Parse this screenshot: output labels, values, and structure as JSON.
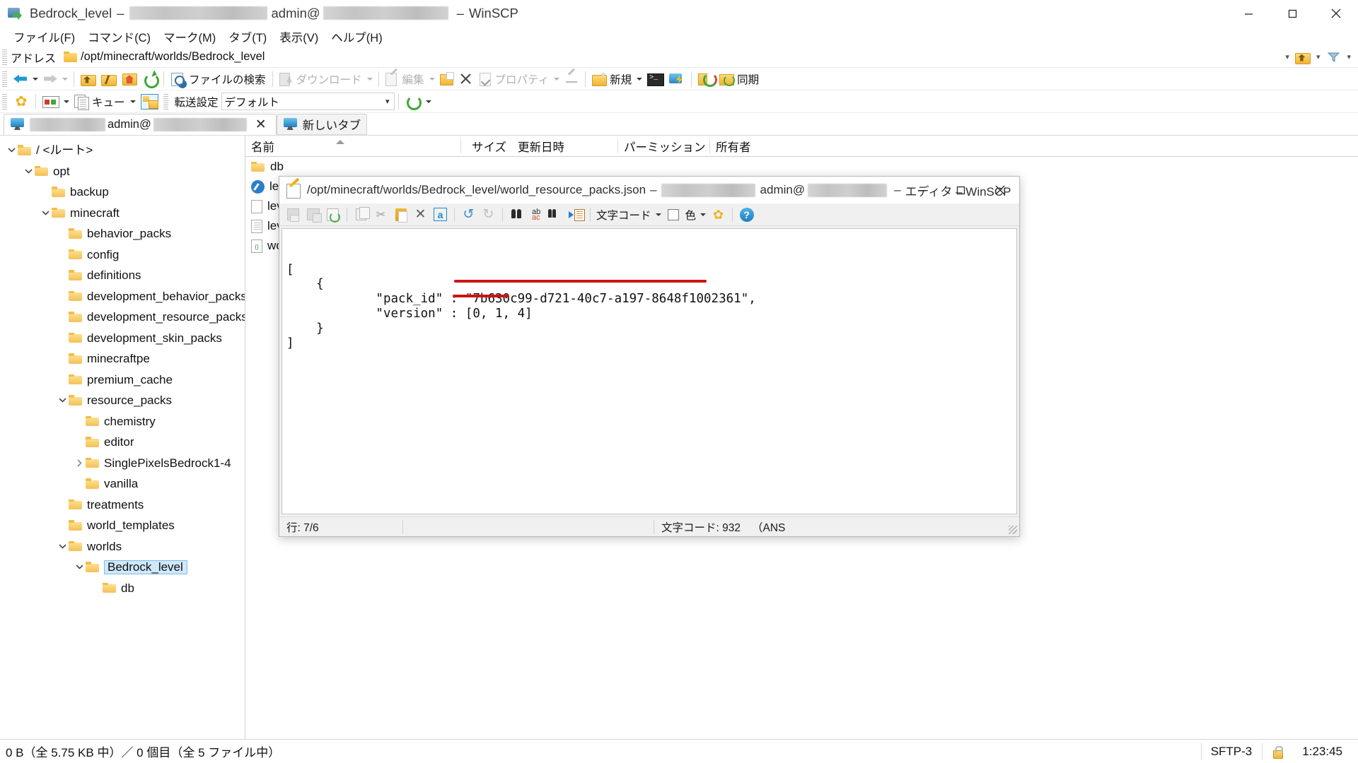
{
  "window": {
    "title_prefix": "Bedrock_level",
    "title_dash1": "–",
    "title_user": "admin@",
    "title_dash2": "–",
    "title_app": "WinSCP",
    "icon": "winscp-folder-arrow-icon"
  },
  "menu": {
    "items": [
      {
        "label": "ファイル(F)",
        "name": "menu-file"
      },
      {
        "label": "コマンド(C)",
        "name": "menu-command"
      },
      {
        "label": "マーク(M)",
        "name": "menu-mark"
      },
      {
        "label": "タブ(T)",
        "name": "menu-tab"
      },
      {
        "label": "表示(V)",
        "name": "menu-view"
      },
      {
        "label": "ヘルプ(H)",
        "name": "menu-help"
      }
    ]
  },
  "address": {
    "label": "アドレス",
    "path": "/opt/minecraft/worlds/Bedrock_level"
  },
  "toolbar": {
    "back": "",
    "forward": "",
    "search_label": "ファイルの検索",
    "download_label": "ダウンロード",
    "edit_label": "編集",
    "properties_label": "プロパティ",
    "new_label": "新規",
    "sync_label": "同期"
  },
  "toolbar2": {
    "queue_label": "キュー",
    "transfer_settings_label": "転送設定",
    "transfer_settings_value": "デフォルト"
  },
  "tabs": {
    "session_user": "admin@",
    "new_tab_label": "新しいタブ",
    "close_glyph": "✕"
  },
  "tree": [
    {
      "label": "/ <ルート>",
      "depth": 0,
      "state": "expanded",
      "selected": false
    },
    {
      "label": "opt",
      "depth": 1,
      "state": "expanded",
      "selected": false
    },
    {
      "label": "backup",
      "depth": 2,
      "state": "leaf",
      "selected": false
    },
    {
      "label": "minecraft",
      "depth": 2,
      "state": "expanded",
      "selected": false
    },
    {
      "label": "behavior_packs",
      "depth": 3,
      "state": "leaf",
      "selected": false
    },
    {
      "label": "config",
      "depth": 3,
      "state": "leaf",
      "selected": false
    },
    {
      "label": "definitions",
      "depth": 3,
      "state": "leaf",
      "selected": false
    },
    {
      "label": "development_behavior_packs",
      "depth": 3,
      "state": "leaf",
      "selected": false
    },
    {
      "label": "development_resource_packs",
      "depth": 3,
      "state": "leaf",
      "selected": false
    },
    {
      "label": "development_skin_packs",
      "depth": 3,
      "state": "leaf",
      "selected": false
    },
    {
      "label": "minecraftpe",
      "depth": 3,
      "state": "leaf",
      "selected": false
    },
    {
      "label": "premium_cache",
      "depth": 3,
      "state": "leaf",
      "selected": false
    },
    {
      "label": "resource_packs",
      "depth": 3,
      "state": "expanded",
      "selected": false
    },
    {
      "label": "chemistry",
      "depth": 4,
      "state": "leaf",
      "selected": false
    },
    {
      "label": "editor",
      "depth": 4,
      "state": "leaf",
      "selected": false
    },
    {
      "label": "SinglePixelsBedrock1-4",
      "depth": 4,
      "state": "collapsed",
      "selected": false
    },
    {
      "label": "vanilla",
      "depth": 4,
      "state": "leaf",
      "selected": false
    },
    {
      "label": "treatments",
      "depth": 3,
      "state": "leaf",
      "selected": false
    },
    {
      "label": "world_templates",
      "depth": 3,
      "state": "leaf",
      "selected": false
    },
    {
      "label": "worlds",
      "depth": 3,
      "state": "expanded",
      "selected": false
    },
    {
      "label": "Bedrock_level",
      "depth": 4,
      "state": "expanded",
      "selected": true
    },
    {
      "label": "db",
      "depth": 5,
      "state": "leaf",
      "selected": false
    }
  ],
  "filelist": {
    "columns": [
      {
        "label": "名前",
        "name": "column-name"
      },
      {
        "label": "サイズ",
        "name": "column-size"
      },
      {
        "label": "更新日時",
        "name": "column-modified"
      },
      {
        "label": "パーミッション",
        "name": "column-permissions"
      },
      {
        "label": "所有者",
        "name": "column-owner"
      }
    ],
    "rows": [
      {
        "name": "db",
        "icon": "folder-icon"
      },
      {
        "name": "lev",
        "icon": "blue-check-icon"
      },
      {
        "name": "lev",
        "icon": "document-icon"
      },
      {
        "name": "lev",
        "icon": "text-document-icon"
      },
      {
        "name": "wo",
        "icon": "json-file-icon"
      }
    ]
  },
  "editor": {
    "title_path": "/opt/minecraft/worlds/Bedrock_level/world_resource_packs.json",
    "title_dash1": "–",
    "title_user": "admin@",
    "title_dash2": "–",
    "title_suffix": "エディタ – WinSCP",
    "toolbar": {
      "encoding_label": "文字コード",
      "color_label": "色"
    },
    "code_lines": [
      "[",
      "    {",
      "            \"pack_id\" : \"7b630c99-d721-40c7-a197-8648f1002361\",",
      "            \"version\" : [0, 1, 4]",
      "    }",
      "]",
      ""
    ],
    "status": {
      "line_label": "行: 7/6",
      "encoding_label": "文字コード: 932",
      "encoding_paren": "（ANS"
    },
    "annotations": [
      {
        "name": "pack-id-underline",
        "color": "#cc1414"
      },
      {
        "name": "version-underline",
        "color": "#cc1414"
      }
    ]
  },
  "statusbar": {
    "left": "0 B（全 5.75 KB 中）／ 0 個目（全 5 ファイル中）",
    "protocol": "SFTP-3",
    "lock_icon": "lock-icon",
    "time": "1:23:45"
  }
}
